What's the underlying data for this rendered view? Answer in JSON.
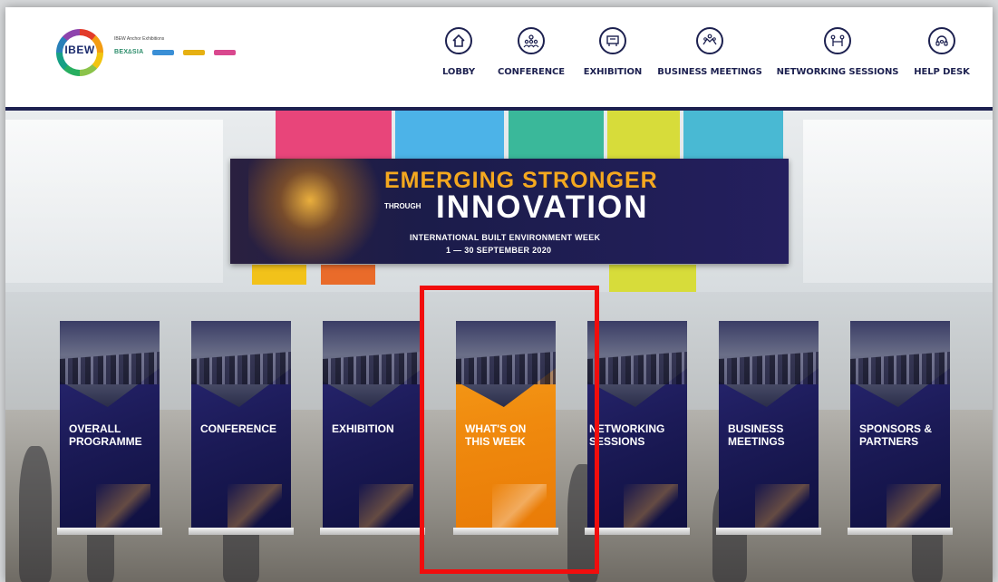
{
  "header": {
    "logo_text": "IBEW",
    "anchor_label": "IBEW Anchor Exhibitions",
    "brand_bexi": "BEX∆SIA",
    "brand_colors": [
      "#3a8fd6",
      "#e6b012",
      "#d9488e"
    ]
  },
  "nav": [
    {
      "label": "LOBBY",
      "icon": "home-icon"
    },
    {
      "label": "CONFERENCE",
      "icon": "audience-icon"
    },
    {
      "label": "EXHIBITION",
      "icon": "booth-icon"
    },
    {
      "label": "BUSINESS MEETINGS",
      "icon": "handshake-icon"
    },
    {
      "label": "NETWORKING SESSIONS",
      "icon": "people-connect-icon"
    },
    {
      "label": "HELP DESK",
      "icon": "headset-icon"
    }
  ],
  "banner": {
    "line1": "EMERGING STRONGER",
    "through": "THROUGH",
    "line2": "INNOVATION",
    "line3": "INTERNATIONAL BUILT ENVIRONMENT WEEK",
    "line4": "1 — 30 SEPTEMBER 2020"
  },
  "standees": [
    {
      "label": "OVERALL\nPROGRAMME",
      "active": false
    },
    {
      "label": "CONFERENCE",
      "active": false
    },
    {
      "label": "EXHIBITION",
      "active": false
    },
    {
      "label": "WHAT'S ON\nTHIS WEEK",
      "active": true
    },
    {
      "label": "NETWORKING\nSESSIONS",
      "active": false
    },
    {
      "label": "BUSINESS\nMEETINGS",
      "active": false
    },
    {
      "label": "SPONSORS &\nPARTNERS",
      "active": false
    }
  ],
  "colors": {
    "nav_text": "#1d2150",
    "banner_accent": "#f4a81f",
    "active_standee": "#f08a0e",
    "highlight": "#f10d0d"
  }
}
